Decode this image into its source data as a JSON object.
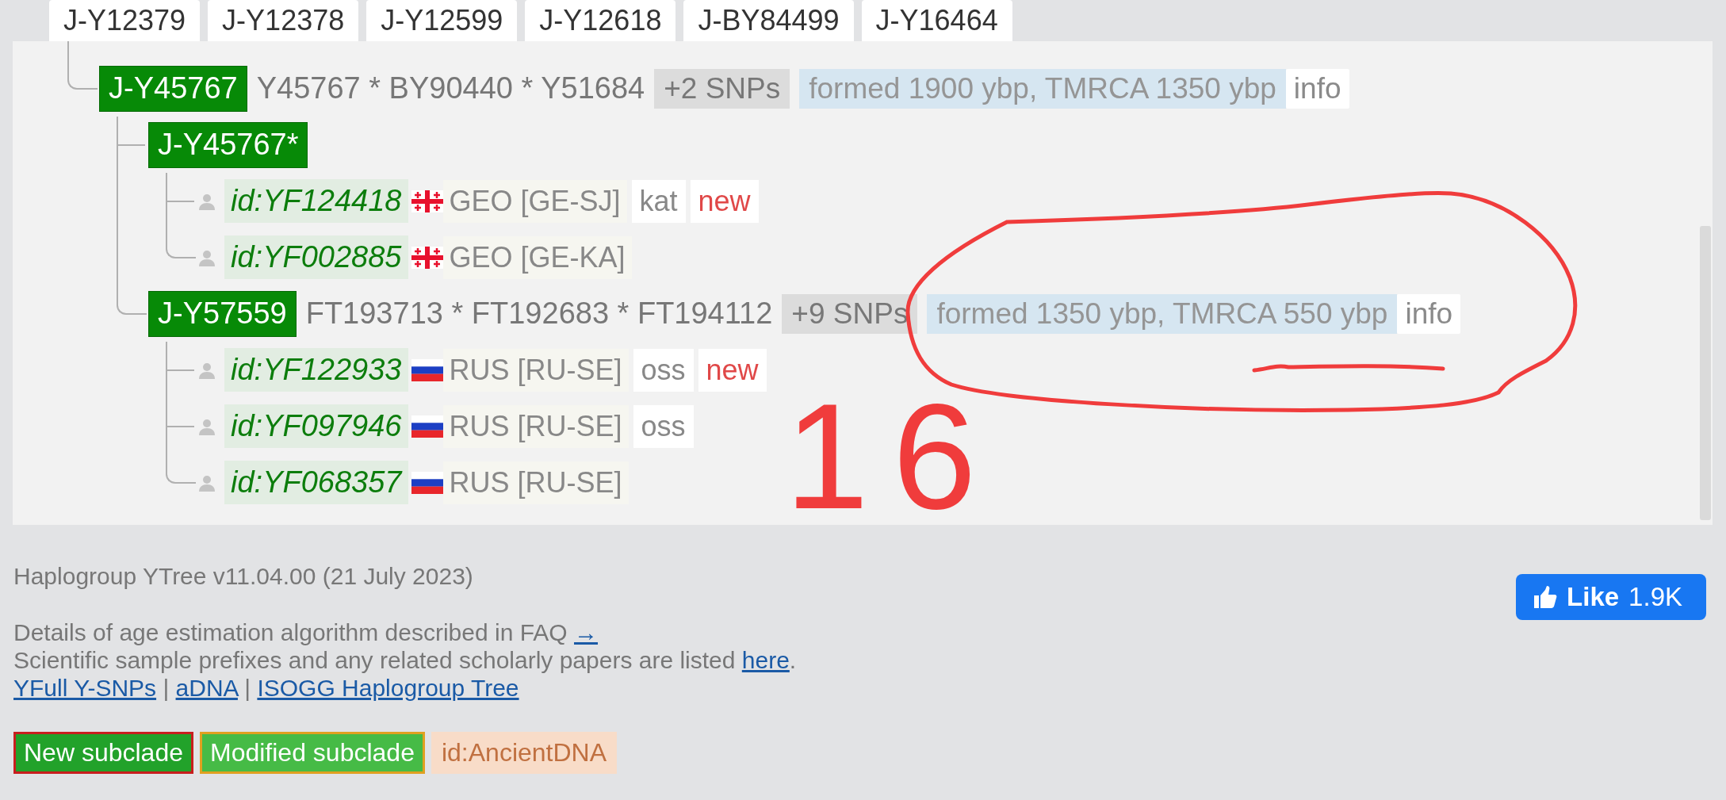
{
  "tabs": [
    {
      "label": "J-Y12379"
    },
    {
      "label": "J-Y12378"
    },
    {
      "label": "J-Y12599"
    },
    {
      "label": "J-Y12618"
    },
    {
      "label": "J-BY84499"
    },
    {
      "label": "J-Y16464"
    }
  ],
  "tree": [
    {
      "kind": "clade",
      "name": "J-Y45767",
      "snps": "Y45767 * BY90440 * Y51684",
      "extra_snps": "+2 SNPs",
      "age": "formed 1900 ybp, TMRCA 1350 ybp",
      "info": "info",
      "children": [
        {
          "kind": "clade",
          "name": "J-Y45767*",
          "children": [
            {
              "kind": "sample",
              "id": "id:YF124418",
              "flag": {
                "kind": "georgia"
              },
              "country": "GEO [GE-SJ]",
              "tags": [
                "kat"
              ],
              "badge": "new"
            },
            {
              "kind": "sample",
              "id": "id:YF002885",
              "flag": {
                "kind": "georgia"
              },
              "country": "GEO [GE-KA]"
            }
          ]
        },
        {
          "kind": "clade",
          "name": "J-Y57559",
          "snps": "FT193713 * FT192683 * FT194112",
          "extra_snps": "+9 SNPs",
          "age": "formed 1350 ybp, TMRCA 550 ybp",
          "info": "info",
          "children": [
            {
              "kind": "sample",
              "id": "id:YF122933",
              "flag": {
                "kind": "russia"
              },
              "country": "RUS [RU-SE]",
              "tags": [
                "oss"
              ],
              "badge": "new"
            },
            {
              "kind": "sample",
              "id": "id:YF097946",
              "flag": {
                "kind": "russia"
              },
              "country": "RUS [RU-SE]",
              "tags": [
                "oss"
              ]
            },
            {
              "kind": "sample",
              "id": "id:YF068357",
              "flag": {
                "kind": "russia"
              },
              "country": "RUS [RU-SE]"
            }
          ]
        }
      ]
    }
  ],
  "footer": {
    "version": "Haplogroup YTree v11.04.00 (21 July 2023)",
    "lines": [
      [
        {
          "text": "Details of age estimation algorithm described in FAQ "
        },
        {
          "link": "→"
        }
      ],
      [
        {
          "text": "Scientific sample prefixes and any related scholarly papers are listed "
        },
        {
          "link": "here"
        },
        {
          "text": "."
        }
      ],
      [
        {
          "link": "YFull Y-SNPs"
        },
        {
          "text": " | "
        },
        {
          "link": "aDNA"
        },
        {
          "text": " | "
        },
        {
          "link": "ISOGG Haplogroup Tree"
        }
      ]
    ],
    "legend": [
      {
        "kind": "new",
        "label": "New subclade"
      },
      {
        "kind": "modified",
        "label": "Modified subclade"
      },
      {
        "kind": "ancient",
        "label": "id:AncientDNA"
      }
    ],
    "like": {
      "label": "Like",
      "count": "1.9K"
    }
  },
  "annotation": {
    "note": "16"
  }
}
